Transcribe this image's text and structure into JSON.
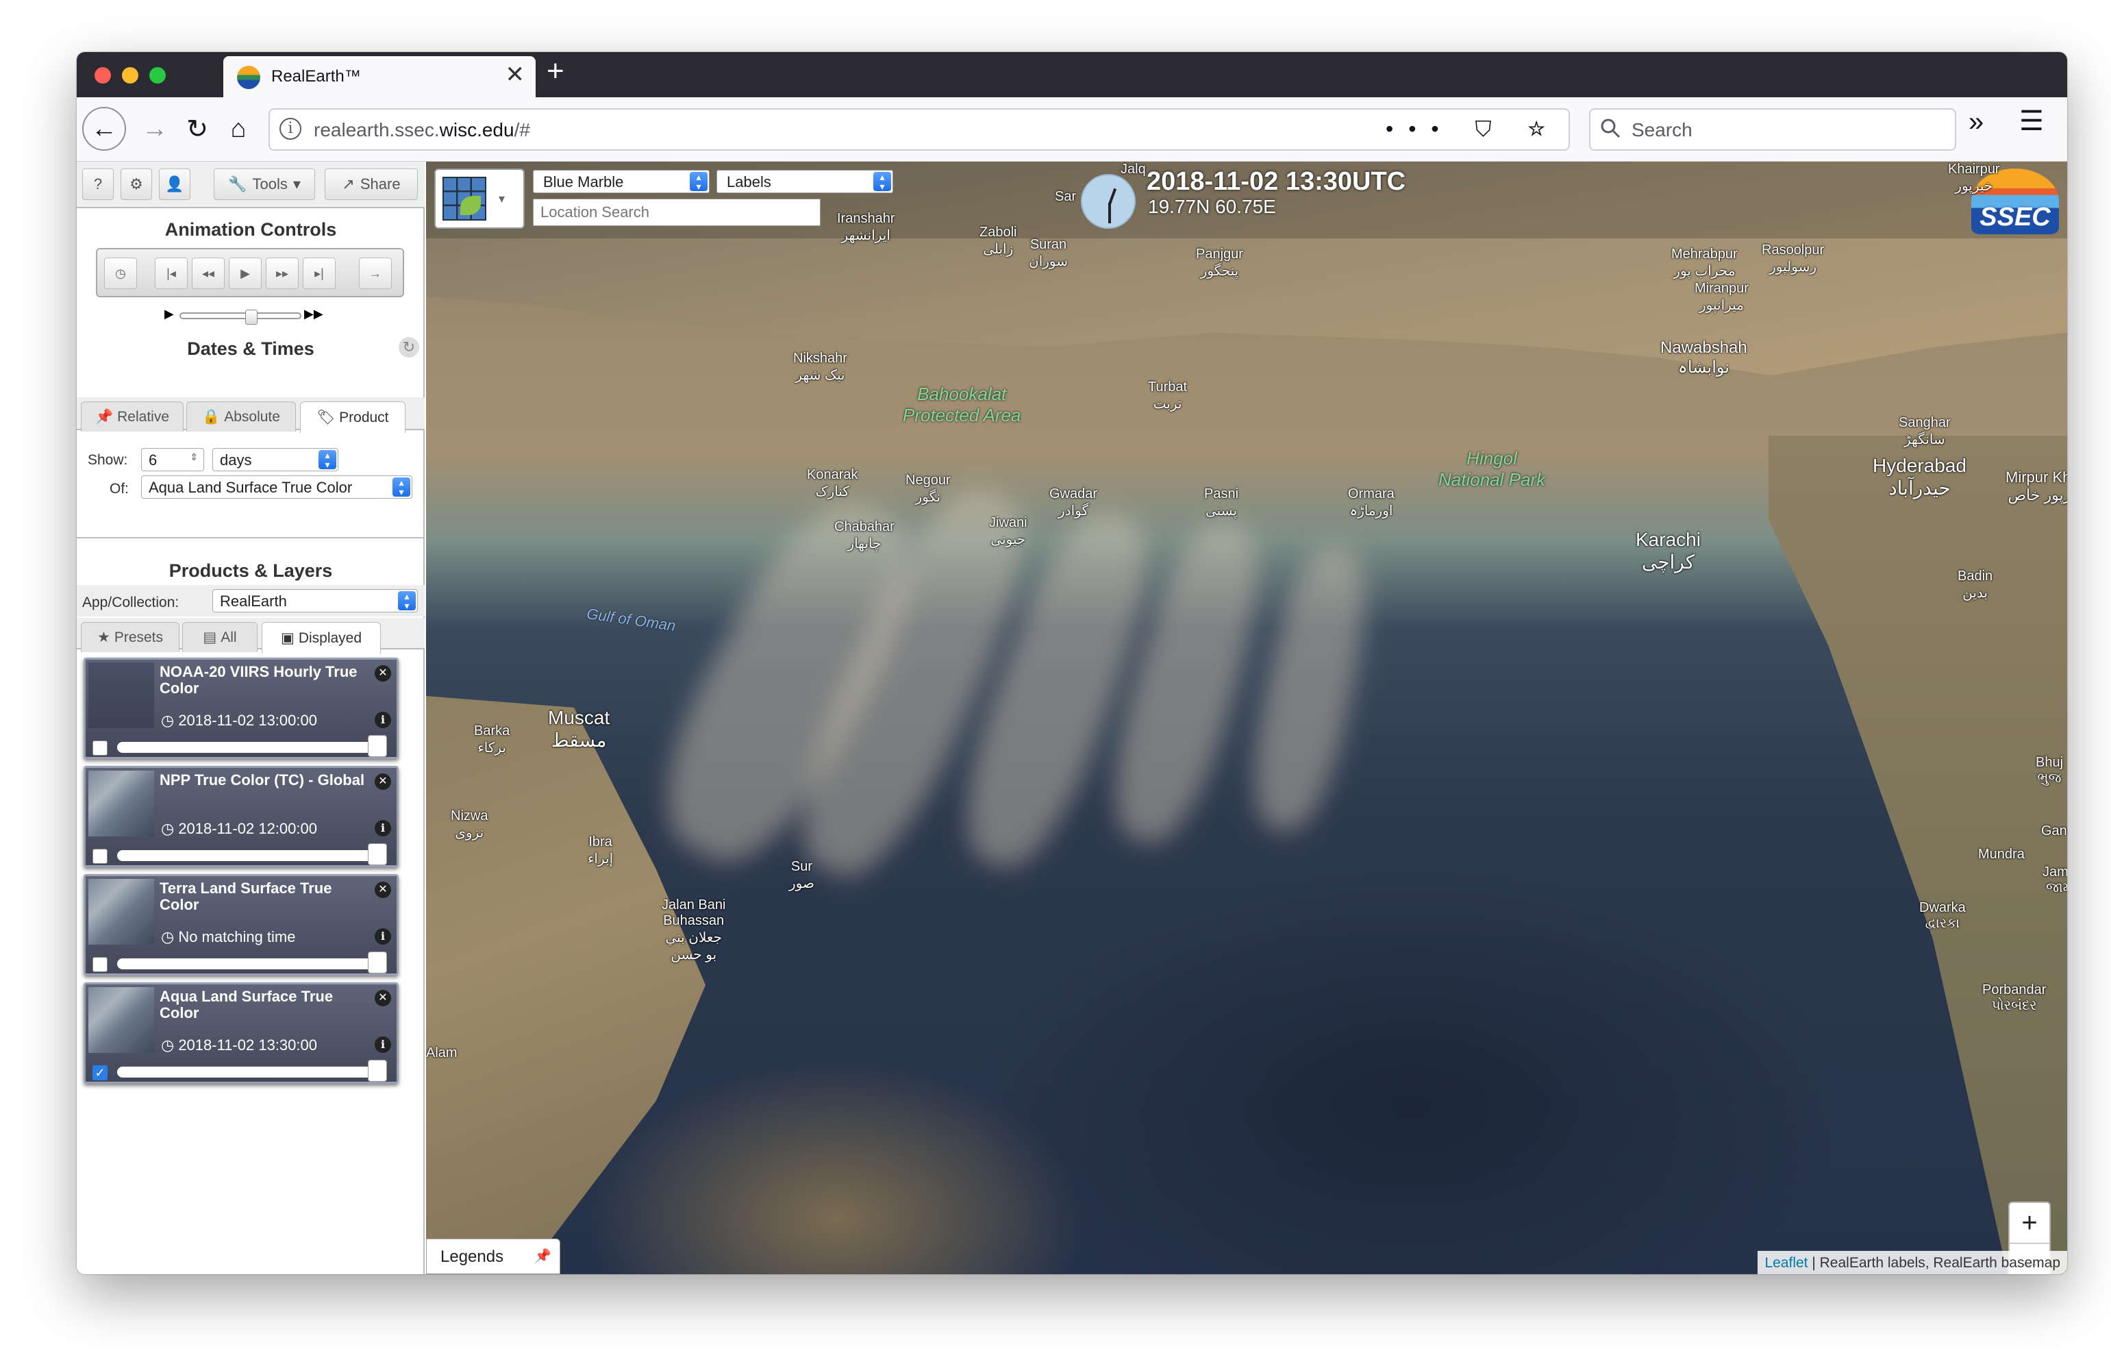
{
  "browser": {
    "tab_title": "RealEarth™",
    "tab_close": "✕",
    "new_tab": "+",
    "url_host": "realearth.ssec.",
    "url_domain": "wisc.edu",
    "url_path": "/#",
    "url_icons": "••• ⛉ ☆",
    "search_placeholder": "Search"
  },
  "toolbar": {
    "help_label": "?",
    "settings_label": "⚙",
    "user_label": "👤",
    "tools_label": "Tools",
    "share_label": "Share"
  },
  "animation": {
    "title": "Animation Controls"
  },
  "dates": {
    "title": "Dates & Times",
    "tabs": [
      "Relative",
      "Absolute",
      "Product"
    ],
    "show_label": "Show:",
    "show_value": "6",
    "unit_value": "days",
    "of_label": "Of:",
    "of_value": "Aqua Land Surface True Color"
  },
  "products": {
    "title": "Products & Layers",
    "app_label": "App/Collection:",
    "app_value": "RealEarth",
    "tabs": [
      "Presets",
      "All",
      "Displayed"
    ]
  },
  "layers": [
    {
      "name": "NOAA-20 VIIRS Hourly True Color",
      "time": "2018-11-02 13:00:00",
      "checked": false
    },
    {
      "name": "NPP True Color (TC) - Global",
      "time": "2018-11-02 12:00:00",
      "checked": false
    },
    {
      "name": "Terra Land Surface True Color",
      "time": "No matching time",
      "checked": false
    },
    {
      "name": "Aqua Land Surface True Color",
      "time": "2018-11-02 13:30:00",
      "checked": true
    }
  ],
  "map": {
    "basemap_select": "Blue Marble",
    "labels_select": "Labels",
    "location_placeholder": "Location Search",
    "datetime": "2018-11-02 13:30UTC",
    "coords": "19.77N 60.75E",
    "logo_text": "SSEC",
    "zoom_in": "+",
    "zoom_out": "−",
    "legends_label": "Legends",
    "attrib_link": "Leaflet",
    "attrib_text": " | RealEarth labels, RealEarth basemap",
    "places": {
      "iranshahr": "Iranshahr\nایرانشهر",
      "zaboli": "Zaboli\nزابلی",
      "suran": "Suran\nسوران",
      "panjgur": "Panjgur\nپنجگور",
      "khairpur": "Khairpur\nخیرپور",
      "mehrabpur": "Mehrabpur\nمحراب پور",
      "rasoolpur": "Rasoolpur\nرسولپور",
      "mirानpur": "Miranpur\nمیرانپور",
      "nawabshah": "Nawabshah\nنوابشاہ",
      "nikshahr": "Nikshahr\nنیک شهر",
      "bahookalat": "Bahookalat\nProtected Area",
      "turbat": "Turbat\nتربت",
      "sanghar": "Sanghar\nسانگھڑ",
      "hyderabad": "Hyderabad\nحیدرآباد",
      "mirpur_khas": "Mirpur Khas\nمیرپور خاص",
      "konarak": "Konarak\nکنارک",
      "negour": "Negour\nنگور",
      "gwadar": "Gwadar\nگوادر",
      "pasni": "Pasni\nپسنی",
      "ormara": "Ormara\nاورماڑہ",
      "hingol": "Hingol\nNational Park",
      "chabahar": "Chabahar\nچابهار",
      "jiwani": "Jiwani\nجیونی",
      "karachi": "Karachi\nکراچی",
      "badin": "Badin\nبدین",
      "gulf_of_oman": "Gulf of Oman",
      "muscat": "Muscat\nمسقط",
      "barka": "Barka\nبركاء",
      "nizwa": "Nizwa\nنزوى",
      "ibra": "Ibra\nإبراء",
      "sur": "Sur\nصور",
      "jalan": "Jalan Bani\nBuhassan\nجعلان بني\nبو حسن",
      "alam": "Alam",
      "bhuj": "Bhuj\nભુજ",
      "gandhi": "Gandhi",
      "mundra": "Mundra",
      "jamn": "Jamn\nજામ",
      "dwarka": "Dwarka\nદ્વારકા",
      "porbandar": "Porbandar\nપોરબંદર",
      "sar": "Sar",
      "jalq": "Jalq"
    }
  }
}
